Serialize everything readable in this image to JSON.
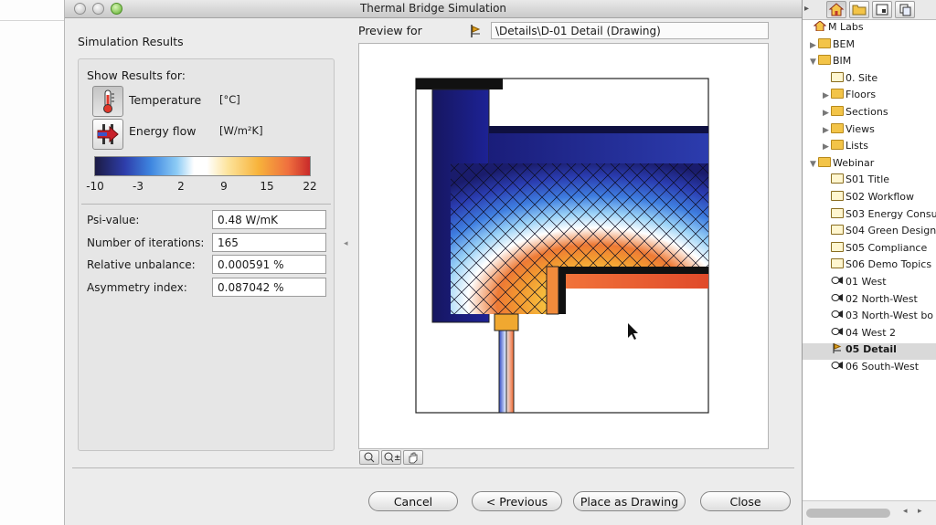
{
  "window": {
    "title": "Thermal Bridge Simulation"
  },
  "left": {
    "section_title": "Simulation Results",
    "show_results_label": "Show Results for:",
    "options": [
      {
        "label": "Temperature",
        "unit": "[°C]",
        "icon": "thermometer-icon",
        "selected": true
      },
      {
        "label": "Energy flow",
        "unit": "[W/m²K]",
        "icon": "energy-flow-icon",
        "selected": false
      }
    ],
    "color_scale_ticks": [
      "-10",
      "-3",
      "2",
      "9",
      "15",
      "22"
    ],
    "fields": [
      {
        "label": "Psi-value:",
        "value": "0.48 W/mK"
      },
      {
        "label": "Number of iterations:",
        "value": "165"
      },
      {
        "label": "Relative unbalance:",
        "value": "0.000591 %"
      },
      {
        "label": "Asymmetry index:",
        "value": "0.087042 %"
      }
    ]
  },
  "preview": {
    "label": "Preview for",
    "path": "\\Details\\D-01 Detail (Drawing)",
    "icon": "detail-marker-icon"
  },
  "zoom_tools": [
    "zoom-fit-icon",
    "zoom-in-out-icon",
    "pan-hand-icon"
  ],
  "buttons": {
    "cancel": "Cancel",
    "previous": "< Previous",
    "place": "Place as Drawing",
    "close": "Close"
  },
  "sidebar": {
    "toolbar_icons": [
      "home-icon",
      "folder-icon",
      "layout-icon",
      "copy-icon"
    ],
    "tree": [
      {
        "label": "M Labs",
        "depth": 0,
        "icon": "project-icon",
        "expander": ""
      },
      {
        "label": "BEM",
        "depth": 1,
        "icon": "folder",
        "expander": "▶"
      },
      {
        "label": "BIM",
        "depth": 1,
        "icon": "folder",
        "expander": "▼"
      },
      {
        "label": "0. Site",
        "depth": 2,
        "icon": "page",
        "expander": ""
      },
      {
        "label": "Floors",
        "depth": 2,
        "icon": "folder",
        "expander": "▶"
      },
      {
        "label": "Sections",
        "depth": 2,
        "icon": "folder",
        "expander": "▶"
      },
      {
        "label": "Views",
        "depth": 2,
        "icon": "folder",
        "expander": "▶"
      },
      {
        "label": "Lists",
        "depth": 2,
        "icon": "folder",
        "expander": "▶"
      },
      {
        "label": "Webinar",
        "depth": 1,
        "icon": "folder",
        "expander": "▼"
      },
      {
        "label": "S01 Title",
        "depth": 2,
        "icon": "page",
        "expander": ""
      },
      {
        "label": "S02 Workflow",
        "depth": 2,
        "icon": "page",
        "expander": ""
      },
      {
        "label": "S03 Energy Consu",
        "depth": 2,
        "icon": "page",
        "expander": ""
      },
      {
        "label": "S04 Green Design",
        "depth": 2,
        "icon": "page",
        "expander": ""
      },
      {
        "label": "S05 Compliance",
        "depth": 2,
        "icon": "page",
        "expander": ""
      },
      {
        "label": "S06 Demo Topics",
        "depth": 2,
        "icon": "page",
        "expander": ""
      },
      {
        "label": "01 West",
        "depth": 2,
        "icon": "camera",
        "expander": ""
      },
      {
        "label": "02 North-West",
        "depth": 2,
        "icon": "camera",
        "expander": ""
      },
      {
        "label": "03 North-West bo",
        "depth": 2,
        "icon": "camera",
        "expander": ""
      },
      {
        "label": "04 West 2",
        "depth": 2,
        "icon": "camera",
        "expander": ""
      },
      {
        "label": "05 Detail",
        "depth": 2,
        "icon": "detail",
        "expander": "",
        "selected": true
      },
      {
        "label": "06 South-West",
        "depth": 2,
        "icon": "camera",
        "expander": ""
      }
    ]
  }
}
